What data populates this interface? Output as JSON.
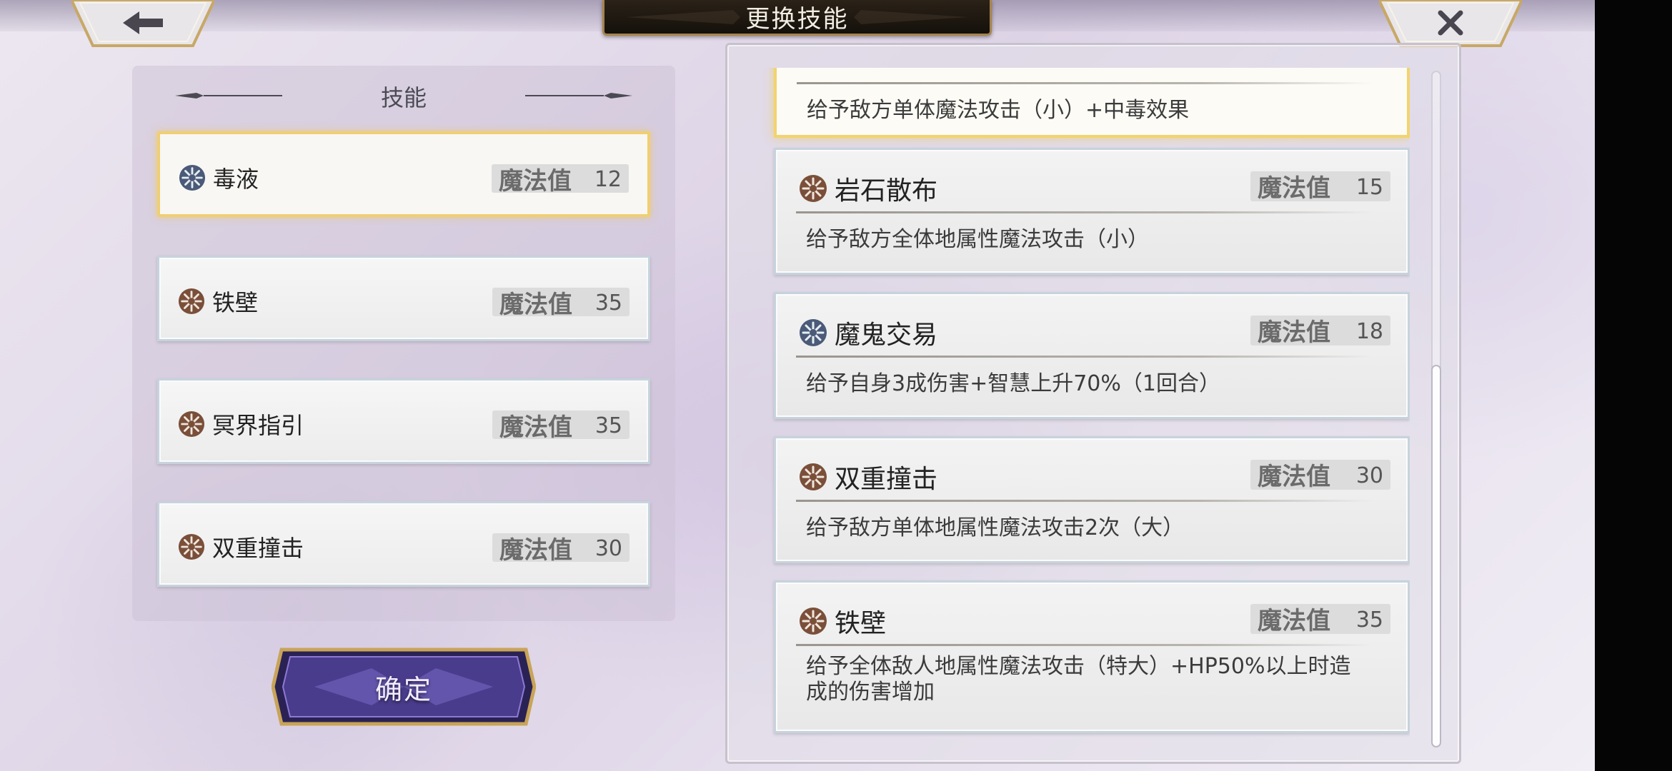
{
  "header": {
    "title": "更换技能",
    "back_icon": "arrow-left-icon",
    "close_icon": "close-x-icon"
  },
  "left_panel": {
    "section_title": "技能",
    "slots": [
      {
        "name": "毒液",
        "mp_label": "魔法值",
        "mp": "12",
        "element": "wind",
        "selected": true
      },
      {
        "name": "铁壁",
        "mp_label": "魔法值",
        "mp": "35",
        "element": "earth",
        "selected": false
      },
      {
        "name": "冥界指引",
        "mp_label": "魔法值",
        "mp": "35",
        "element": "earth",
        "selected": false
      },
      {
        "name": "双重撞击",
        "mp_label": "魔法值",
        "mp": "30",
        "element": "earth",
        "selected": false
      }
    ],
    "confirm_label": "确定"
  },
  "skill_list": {
    "items": [
      {
        "name": "",
        "mp_label": "",
        "mp": "",
        "desc": "给予敌方单体魔法攻击（小）+中毒效果",
        "selected": true
      },
      {
        "name": "岩石散布",
        "mp_label": "魔法值",
        "mp": "15",
        "desc": "给予敌方全体地属性魔法攻击（小）",
        "element": "earth"
      },
      {
        "name": "魔鬼交易",
        "mp_label": "魔法值",
        "mp": "18",
        "desc": "给予自身3成伤害+智慧上升70%（1回合）",
        "element": "wind"
      },
      {
        "name": "双重撞击",
        "mp_label": "魔法值",
        "mp": "30",
        "desc": "给予敌方单体地属性魔法攻击2次（大）",
        "element": "earth"
      },
      {
        "name": "铁壁",
        "mp_label": "魔法值",
        "mp": "35",
        "desc": "给予全体敌人地属性魔法攻击（特大）+HP50%以上时造成的伤害增加",
        "element": "earth"
      }
    ]
  },
  "colors": {
    "earth_icon": "#7a4f3a",
    "wind_icon": "#4a5a78",
    "selected_border": "#f0cf72",
    "title_plate": "#1c1610"
  }
}
